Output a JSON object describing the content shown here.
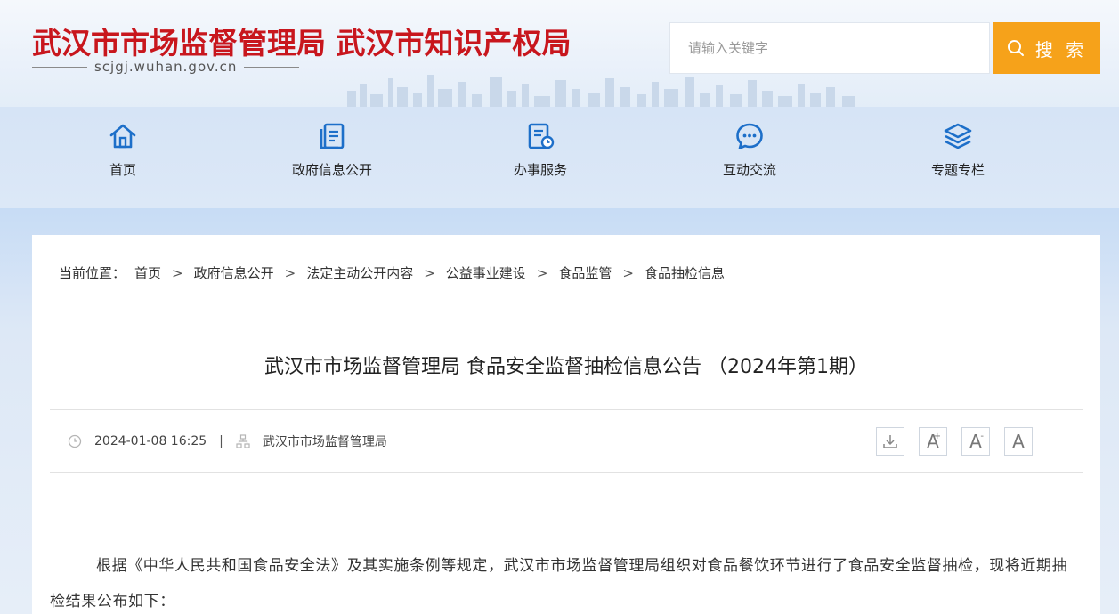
{
  "header": {
    "site_title": "武汉市市场监督管理局 武汉市知识产权局",
    "site_domain": "scjgj.wuhan.gov.cn",
    "search_placeholder": "请输入关键字",
    "search_button": "搜 索"
  },
  "nav": {
    "items": [
      {
        "label": "首页",
        "icon": "home-icon"
      },
      {
        "label": "政府信息公开",
        "icon": "document-icon"
      },
      {
        "label": "办事服务",
        "icon": "service-icon"
      },
      {
        "label": "互动交流",
        "icon": "chat-icon"
      },
      {
        "label": "专题专栏",
        "icon": "layers-icon"
      }
    ]
  },
  "breadcrumb": {
    "prefix": "当前位置：",
    "items": [
      "首页",
      "政府信息公开",
      "法定主动公开内容",
      "公益事业建设",
      "食品监管",
      "食品抽检信息"
    ],
    "separator": ">"
  },
  "article": {
    "title": "武汉市市场监督管理局 食品安全监督抽检信息公告 （2024年第1期）",
    "date": "2024-01-08 16:25",
    "meta_divider": "|",
    "source": "武汉市市场监督管理局",
    "body": "根据《中华人民共和国食品安全法》及其实施条例等规定，武汉市市场监督管理局组织对食品餐饮环节进行了食品安全监督抽检，现将近期抽检结果公布如下："
  },
  "tools": {
    "font_large": "A",
    "font_large_mark": "+",
    "font_small": "A",
    "font_small_mark": "-",
    "font_normal": "A"
  },
  "colors": {
    "brand_red": "#c8161d",
    "accent_orange": "#f6a21a",
    "nav_blue": "#1d6fc9"
  }
}
